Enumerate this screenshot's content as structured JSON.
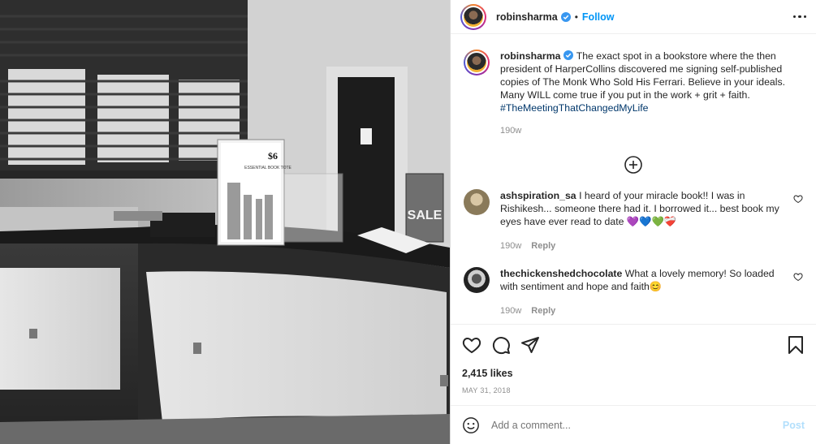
{
  "post": {
    "author": "robinsharma",
    "follow_label": "Follow",
    "separator": "•",
    "caption_author": "robinsharma",
    "caption_text": "The exact spot in a bookstore where the then president of HarperCollins discovered me signing self-published copies of The Monk Who Sold His Ferrari. Believe in your ideals. Many WILL come true if you put in the work + grit + faith.",
    "caption_hashtag": "#TheMeetingThatChangedMyLife",
    "caption_age": "190w",
    "likes": "2,415 likes",
    "date": "MAY 31, 2018"
  },
  "photo": {
    "sign_price": "$6",
    "sign_title": "ESSENTIAL BOOK TOTE",
    "sale_sign": "SALE"
  },
  "comments": [
    {
      "user": "ashspiration_sa",
      "text": "I heard of your miracle book!! I was in Rishikesh... someone there had it. I borrowed it... best book my eyes have ever read to date 💜💙💚❤️‍🩹",
      "age": "190w",
      "reply_label": "Reply"
    },
    {
      "user": "thechickenshedchocolate",
      "text": "What a lovely memory! So loaded with sentiment and hope and faith😊",
      "age": "190w",
      "reply_label": "Reply"
    }
  ],
  "add_comment": {
    "placeholder": "Add a comment...",
    "post_label": "Post"
  },
  "icons": {
    "more": "more-options-icon",
    "load_more": "plus-circle-icon",
    "like": "heart-icon",
    "comment": "comment-icon",
    "share": "paper-plane-icon",
    "save": "bookmark-icon",
    "emoji": "emoji-icon",
    "verified": "verified-badge-icon"
  },
  "colors": {
    "accent": "#0095f6",
    "post_disabled": "#b2dffc",
    "muted": "#8e8e8e",
    "hashtag": "#00376b"
  }
}
